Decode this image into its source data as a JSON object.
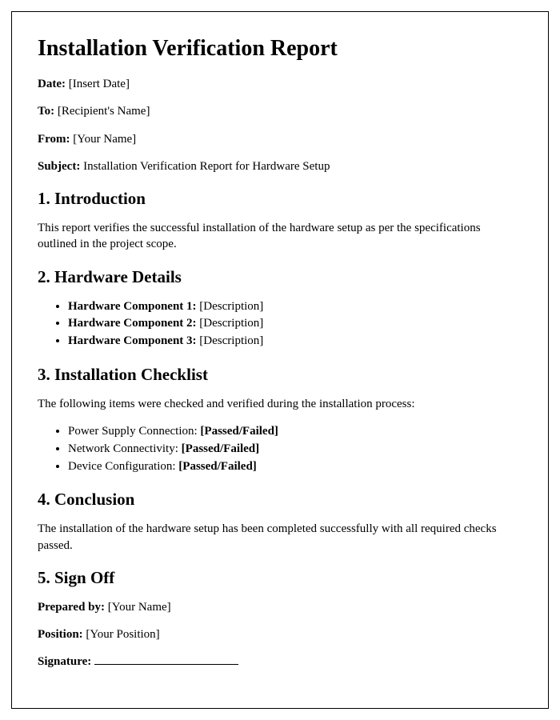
{
  "title": "Installation Verification Report",
  "meta": {
    "date_label": "Date:",
    "date_value": " [Insert Date]",
    "to_label": "To:",
    "to_value": " [Recipient's Name]",
    "from_label": "From:",
    "from_value": " [Your Name]",
    "subject_label": "Subject:",
    "subject_value": " Installation Verification Report for Hardware Setup"
  },
  "sections": {
    "intro": {
      "heading": "1. Introduction",
      "text": "This report verifies the successful installation of the hardware setup as per the specifications outlined in the project scope."
    },
    "hardware": {
      "heading": "2. Hardware Details",
      "items": [
        {
          "label": "Hardware Component 1:",
          "value": " [Description]"
        },
        {
          "label": "Hardware Component 2:",
          "value": " [Description]"
        },
        {
          "label": "Hardware Component 3:",
          "value": " [Description]"
        }
      ]
    },
    "checklist": {
      "heading": "3. Installation Checklist",
      "intro": "The following items were checked and verified during the installation process:",
      "items": [
        {
          "label": "Power Supply Connection: ",
          "status": "[Passed/Failed]"
        },
        {
          "label": "Network Connectivity: ",
          "status": "[Passed/Failed]"
        },
        {
          "label": "Device Configuration: ",
          "status": "[Passed/Failed]"
        }
      ]
    },
    "conclusion": {
      "heading": "4. Conclusion",
      "text": "The installation of the hardware setup has been completed successfully with all required checks passed."
    },
    "signoff": {
      "heading": "5. Sign Off",
      "prepared_label": "Prepared by:",
      "prepared_value": " [Your Name]",
      "position_label": "Position:",
      "position_value": " [Your Position]",
      "signature_label": "Signature:"
    }
  }
}
